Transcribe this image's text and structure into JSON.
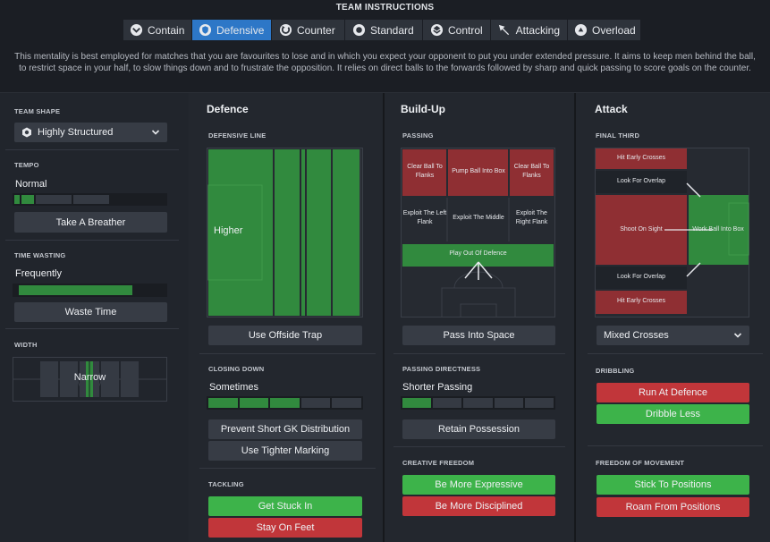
{
  "title": "TEAM INSTRUCTIONS",
  "tabs": [
    {
      "label": "Contain",
      "icon": "contain-icon",
      "active": false
    },
    {
      "label": "Defensive",
      "icon": "shield-icon",
      "active": true
    },
    {
      "label": "Counter",
      "icon": "counter-icon",
      "active": false
    },
    {
      "label": "Standard",
      "icon": "standard-icon",
      "active": false
    },
    {
      "label": "Control",
      "icon": "control-icon",
      "active": false
    },
    {
      "label": "Attacking",
      "icon": "attacking-icon",
      "active": false
    },
    {
      "label": "Overload",
      "icon": "overload-icon",
      "active": false
    }
  ],
  "description": "This mentality is best employed for matches that you are favourites to lose and in which you expect your opponent to put you under extended pressure. It aims to keep men behind the ball, to restrict space in your half, to slow things down and to frustrate the opposition. It relies on direct balls to the forwards followed by sharp and quick passing to score goals on the counter.",
  "left": {
    "team_shape": {
      "label": "TEAM SHAPE",
      "value": "Highly Structured"
    },
    "tempo": {
      "label": "TEMPO",
      "value": "Normal",
      "button": "Take A Breather",
      "level_segments": 1
    },
    "time_wasting": {
      "label": "TIME WASTING",
      "value": "Frequently",
      "button": "Waste Time",
      "level": 0.8
    },
    "width": {
      "label": "WIDTH",
      "value": "Narrow"
    }
  },
  "defence": {
    "header": "Defence",
    "defensive_line": {
      "label": "DEFENSIVE LINE",
      "value": "Higher",
      "button": "Use Offside Trap"
    },
    "closing_down": {
      "label": "CLOSING DOWN",
      "value": "Sometimes",
      "segments_on": 3,
      "segments_total": 5,
      "buttons": [
        "Prevent Short GK Distribution",
        "Use Tighter Marking"
      ]
    },
    "tackling": {
      "label": "TACKLING",
      "buttons": [
        "Get Stuck In",
        "Stay On Feet"
      ]
    }
  },
  "buildup": {
    "header": "Build-Up",
    "passing": {
      "label": "PASSING",
      "zones": {
        "clear_left": "Clear Ball To Flanks",
        "pump": "Pump Ball Into Box",
        "clear_right": "Clear Ball To Flanks",
        "exploit_left": "Exploit The Left Flank",
        "exploit_middle": "Exploit The Middle",
        "exploit_right": "Exploit The Right Flank",
        "play_out": "Play Out Of Defence"
      },
      "button": "Pass Into Space"
    },
    "passing_directness": {
      "label": "PASSING DIRECTNESS",
      "value": "Shorter Passing",
      "segments_on": 1,
      "segments_total": 5,
      "button": "Retain Possession"
    },
    "creative_freedom": {
      "label": "CREATIVE FREEDOM",
      "buttons": [
        "Be More Expressive",
        "Be More Disciplined"
      ]
    }
  },
  "attack": {
    "header": "Attack",
    "final_third": {
      "label": "FINAL THIRD",
      "zones": {
        "cross_top": "Hit Early Crosses",
        "overlap_top": "Look For Overlap",
        "shoot": "Shoot On Sight",
        "work_ball": "Work Ball Into Box",
        "overlap_bottom": "Look For Overlap",
        "cross_bottom": "Hit Early Crosses"
      },
      "dropdown": "Mixed Crosses"
    },
    "dribbling": {
      "label": "DRIBBLING",
      "buttons": [
        "Run At Defence",
        "Dribble Less"
      ]
    },
    "freedom_of_movement": {
      "label": "FREEDOM OF MOVEMENT",
      "buttons": [
        "Stick To Positions",
        "Roam From Positions"
      ]
    }
  },
  "colors": {
    "accent": "#2d77c7",
    "green": "#3db34a",
    "red": "#c1363a",
    "pitch_green": "#318a3e",
    "pitch_red": "#8f2f33"
  }
}
